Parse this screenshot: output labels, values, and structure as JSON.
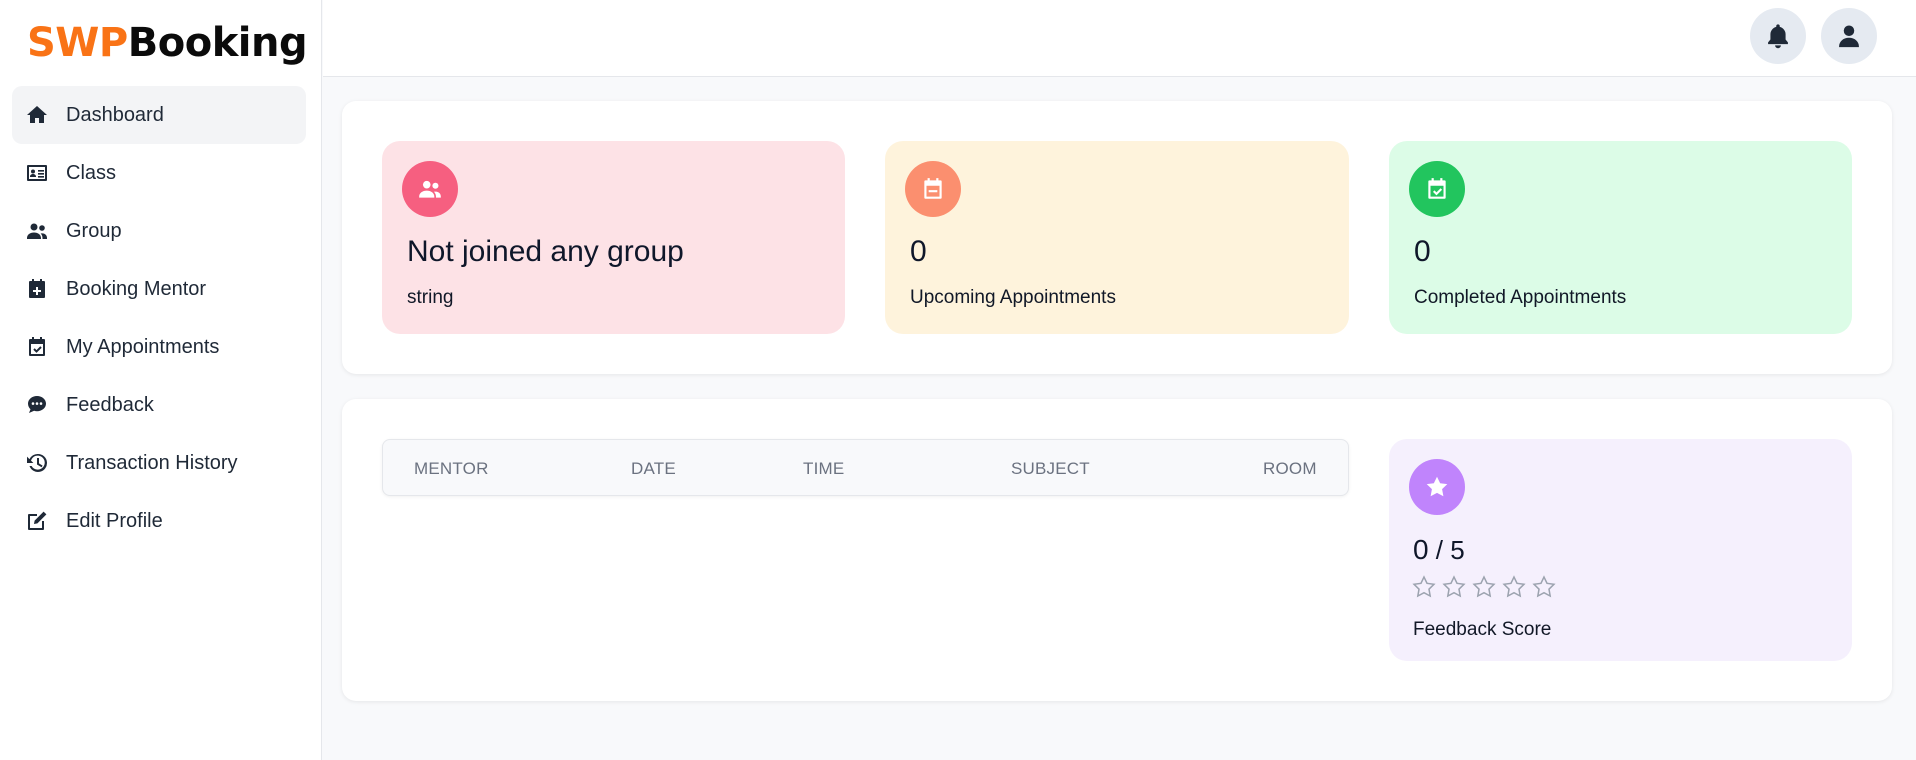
{
  "brand": {
    "part1": "SWP",
    "part2": "Booking",
    "accent": "#f97316"
  },
  "sidebar": {
    "items": [
      {
        "label": "Dashboard",
        "icon": "home-icon",
        "active": true
      },
      {
        "label": "Class",
        "icon": "id-card-icon"
      },
      {
        "label": "Group",
        "icon": "users-icon"
      },
      {
        "label": "Booking Mentor",
        "icon": "calendar-plus-icon"
      },
      {
        "label": "My Appointments",
        "icon": "calendar-check-icon"
      },
      {
        "label": "Feedback",
        "icon": "comment-dots-icon"
      },
      {
        "label": "Transaction History",
        "icon": "history-icon"
      },
      {
        "label": "Edit Profile",
        "icon": "edit-icon"
      }
    ]
  },
  "header": {
    "notifications_icon": "bell-icon",
    "profile_icon": "user-icon"
  },
  "stats": {
    "group": {
      "title": "Not joined any group",
      "subtitle": "string",
      "icon": "users-icon",
      "color": "#f65f80"
    },
    "upcoming": {
      "value": "0",
      "label": "Upcoming Appointments",
      "icon": "calendar-minus-icon",
      "color": "#fb8f6f"
    },
    "completed": {
      "value": "0",
      "label": "Completed Appointments",
      "icon": "calendar-check-icon",
      "color": "#22c55e"
    }
  },
  "table": {
    "columns": [
      "MENTOR",
      "DATE",
      "TIME",
      "SUBJECT",
      "ROOM"
    ],
    "rows": []
  },
  "feedback": {
    "score": "0",
    "separator": " / ",
    "max": "5",
    "rating": 0,
    "label": "Feedback Score",
    "icon": "star-icon",
    "color": "#c084fc"
  }
}
